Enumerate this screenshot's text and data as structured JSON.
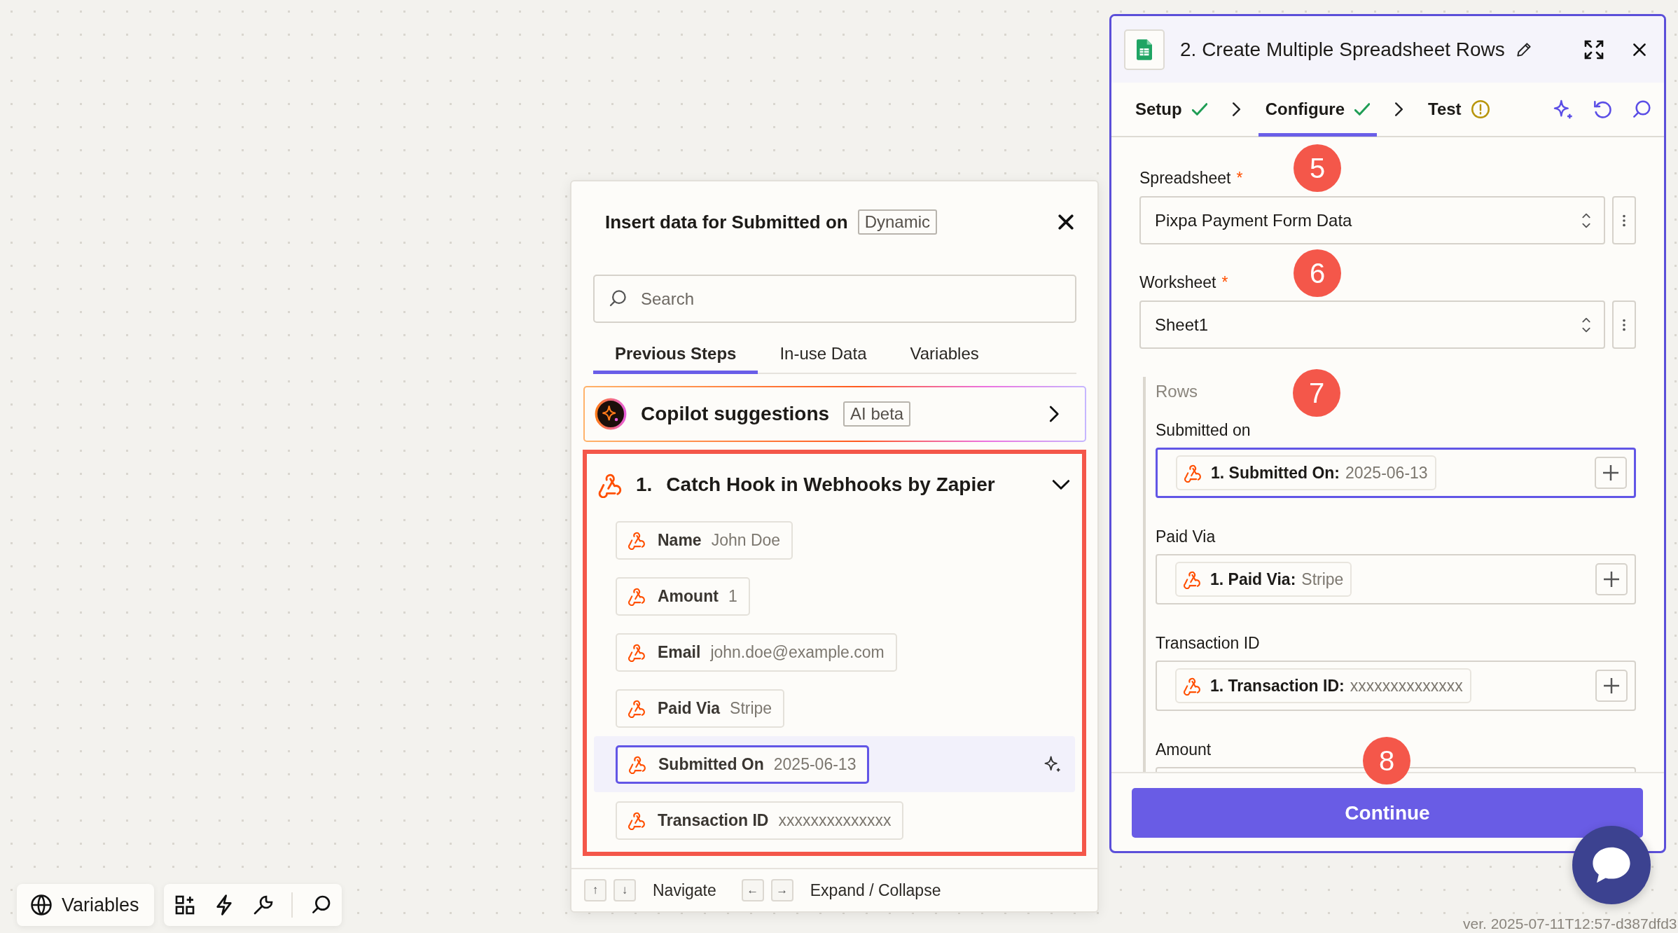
{
  "insert_panel": {
    "title": "Insert data for Submitted on",
    "badge": "Dynamic",
    "search": {
      "placeholder": "Search"
    },
    "tabs": [
      {
        "label": "Previous Steps",
        "selected": true
      },
      {
        "label": "In-use Data",
        "selected": false
      },
      {
        "label": "Variables",
        "selected": false
      }
    ],
    "copilot": {
      "title": "Copilot suggestions",
      "badge": "AI beta"
    },
    "step": {
      "number": "1.",
      "title": "Catch Hook in Webhooks by Zapier",
      "expanded": true,
      "highlighted": true,
      "fields": [
        {
          "name": "Name",
          "value": "John Doe",
          "selected": false
        },
        {
          "name": "Amount",
          "value": "1",
          "selected": false
        },
        {
          "name": "Email",
          "value": "john.doe@example.com",
          "selected": false
        },
        {
          "name": "Paid Via",
          "value": "Stripe",
          "selected": false
        },
        {
          "name": "Submitted On",
          "value": "2025-06-13",
          "selected": true
        },
        {
          "name": "Transaction ID",
          "value": "xxxxxxxxxxxxxx",
          "selected": false
        }
      ]
    },
    "footer": {
      "navigate_keys": [
        "↑",
        "↓"
      ],
      "navigate": "Navigate",
      "expand_keys": [
        "←",
        "→"
      ],
      "expand": "Expand / Collapse"
    }
  },
  "step_panel": {
    "title": "2. Create Multiple Spreadsheet Rows",
    "tabs": [
      {
        "label": "Setup",
        "kind": "done",
        "selected": false
      },
      {
        "label": "Configure",
        "kind": "done",
        "selected": true
      },
      {
        "label": "Test",
        "kind": "warning",
        "selected": false
      }
    ],
    "fields": [
      {
        "label": "Spreadsheet",
        "required_mark": "*",
        "value": "Pixpa Payment Form Data"
      },
      {
        "label": "Worksheet",
        "required_mark": "*",
        "value": "Sheet1"
      }
    ],
    "rows": {
      "title": "Rows",
      "fields": [
        {
          "label": "Submitted on",
          "focused": true,
          "token": {
            "name": "1. Submitted On:",
            "value": "2025-06-13"
          }
        },
        {
          "label": "Paid Via",
          "focused": false,
          "token": {
            "name": "1. Paid Via:",
            "value": "Stripe"
          }
        },
        {
          "label": "Transaction ID",
          "focused": false,
          "token": {
            "name": "1. Transaction ID:",
            "value": "xxxxxxxxxxxxxx"
          }
        },
        {
          "label": "Amount"
        }
      ]
    },
    "continue_button": "Continue"
  },
  "annotations": [
    {
      "label": "5"
    },
    {
      "label": "6"
    },
    {
      "label": "7"
    },
    {
      "label": "8"
    }
  ],
  "toolbar": {
    "variables_button": "Variables"
  },
  "version": "ver. 2025-07-11T12:57-d387dfd3"
}
